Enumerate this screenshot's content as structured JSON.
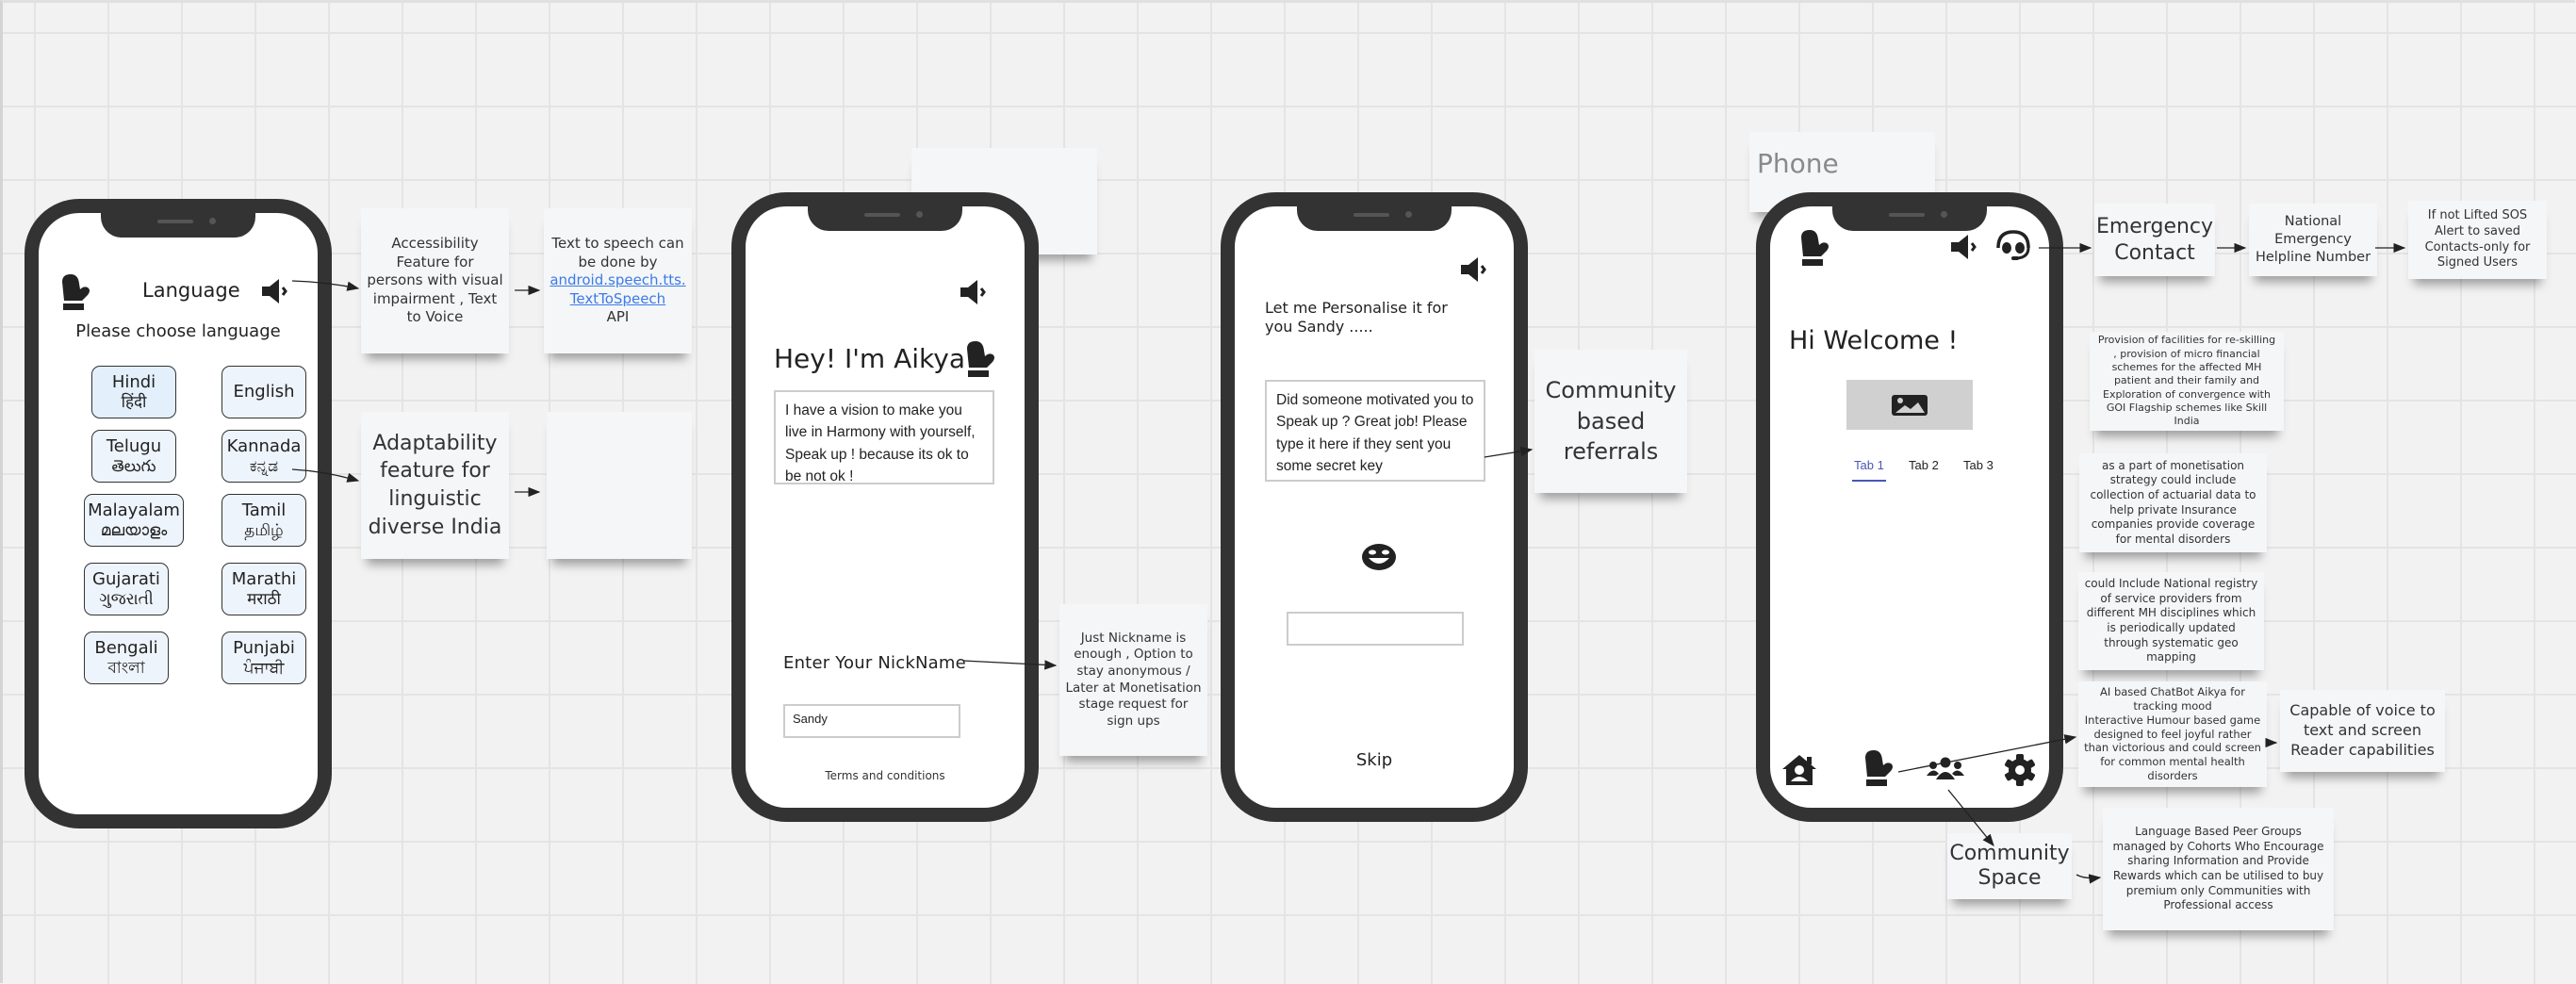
{
  "canvas": {
    "label": "Phone"
  },
  "screens": {
    "language": {
      "title": "Language",
      "subtitle": "Please choose language",
      "languages": [
        {
          "name": "Hindi",
          "native": "हिंदी",
          "selected": true
        },
        {
          "name": "English",
          "native": "",
          "selected": false
        },
        {
          "name": "Telugu",
          "native": "తెలుగు",
          "selected": false
        },
        {
          "name": "Kannada",
          "native": "ಕನ್ನಡ",
          "selected": false
        },
        {
          "name": "Malayalam",
          "native": "മലയാളം",
          "selected": false
        },
        {
          "name": "Tamil",
          "native": "தமிழ்",
          "selected": false
        },
        {
          "name": "Gujarati",
          "native": "ગુજરાતી",
          "selected": false
        },
        {
          "name": "Marathi",
          "native": "मराठी",
          "selected": false
        },
        {
          "name": "Bengali",
          "native": "বাংলা",
          "selected": false
        },
        {
          "name": "Punjabi",
          "native": "ਪੰਜਾਬੀ",
          "selected": false
        }
      ]
    },
    "intro": {
      "heading": "Hey! I'm Aikya",
      "message": "I have a vision to make you live in Harmony with yourself, Speak up ! because its ok to be not ok !",
      "nickname_label": "Enter Your NickName",
      "nickname_value": "Sandy",
      "terms_link": "Terms and conditions"
    },
    "personalise": {
      "greeting": "Let me Personalise it for you Sandy .....",
      "message": "Did someone motivated you to Speak up ? Great job! Please type it here if they sent you some secret key",
      "secret_key_value": "",
      "skip_label": "Skip"
    },
    "home": {
      "welcome": "Hi Welcome !",
      "tabs": [
        {
          "label": "Tab 1",
          "active": true
        },
        {
          "label": "Tab 2",
          "active": false
        },
        {
          "label": "Tab 3",
          "active": false
        }
      ],
      "bottom_nav": [
        "home-icon",
        "mitten-icon",
        "community-icon",
        "settings-icon"
      ]
    }
  },
  "notes": {
    "accessibility": "Accessibility Feature for persons with visual impairment , Text to Voice",
    "tts_prefix": "Text to speech can be done by",
    "tts_link": "android.speech.tts.TextToSpeech",
    "tts_suffix": "API",
    "adaptability": "Adaptability feature for linguistic diverse India",
    "nickname": "Just Nickname is enough , Option to stay anonymous / Later at Monetisation stage request for sign ups",
    "referrals": "Community based referrals",
    "emergency": "Emergency Contact",
    "helpline": "National Emergency Helpline Number",
    "sos": "If not Lifted SOS Alert to saved Contacts-only for Signed Users",
    "provision": "Provision of facilities for re-skilling , provision of micro financial schemes for the affected MH patient and their family and  Exploration of convergence with GOI Flagship schemes like Skill India",
    "monetisation": "as a part of monetisation strategy  could include collection of actuarial data to help private Insurance  companies provide coverage   for mental disorders",
    "registry": "could Include National registry of service providers from different MH disciplines which is periodically updated through systematic geo mapping",
    "chatbot_line1": "AI based ChatBot Aikya for tracking mood",
    "chatbot_line2": "Interactive Humour based game designed to feel joyful rather than victorious and could screen for common mental health disorders",
    "voice": "Capable of voice to text and screen Reader capabilities",
    "community_space": "Community Space",
    "peer_groups_line1": "Language Based Peer Groups managed by Cohorts Who Encourage sharing Information and Provide",
    "peer_groups_line2": "Rewards which can be utilised to buy premium only Communities with Professional access"
  },
  "colors": {
    "frame": "#333333",
    "tab_active": "#4a56b8",
    "link": "#3b7be8",
    "note_bg": "#f5f6f8"
  }
}
